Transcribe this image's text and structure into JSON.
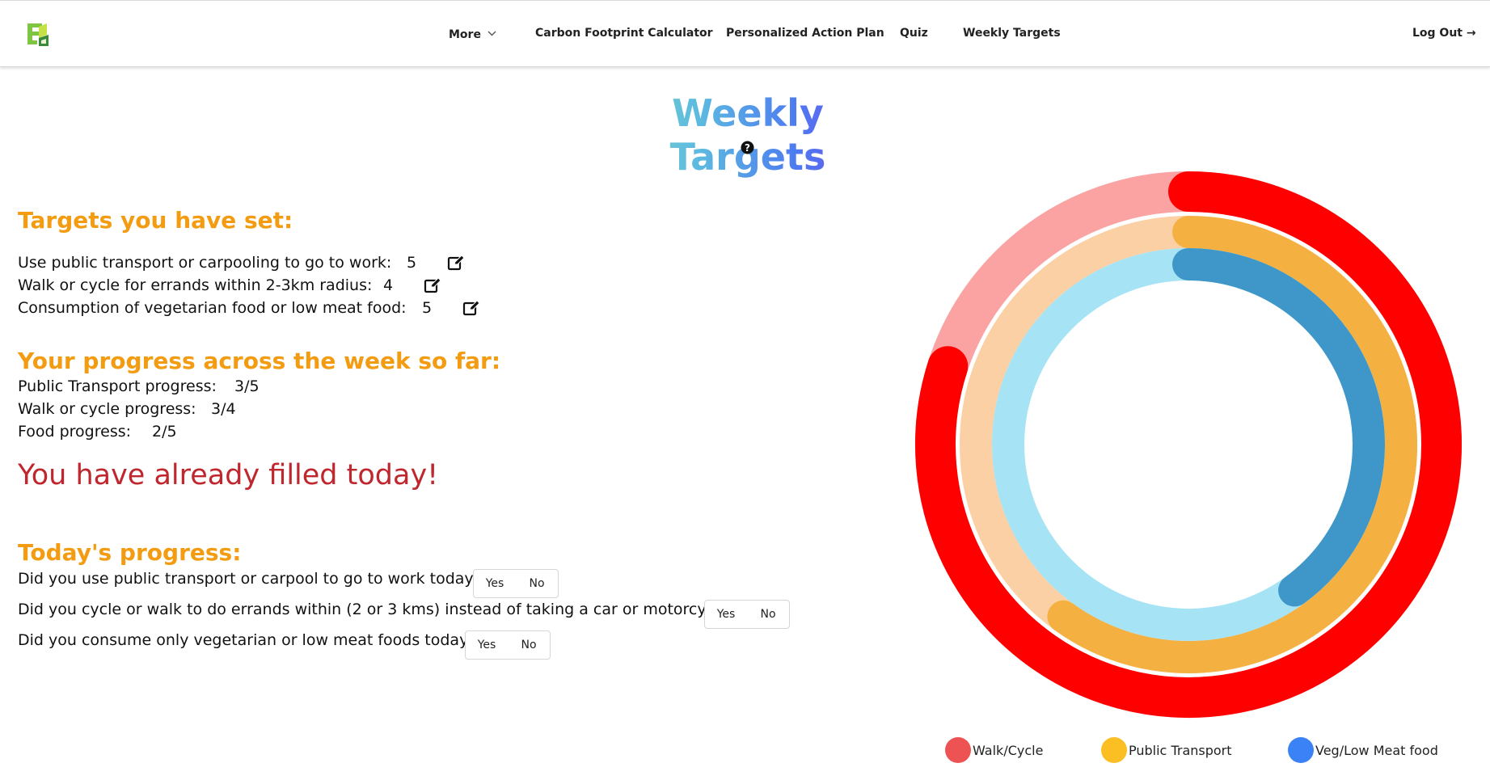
{
  "nav": {
    "more": "More",
    "calculator": "Carbon Footprint Calculator",
    "plan": "Personalized Action Plan",
    "quiz": "Quiz",
    "weekly": "Weekly Targets",
    "logout": "Log Out →"
  },
  "page": {
    "title": "Weekly Targets"
  },
  "targets": {
    "heading": "Targets you have set:",
    "items": [
      {
        "label": "Use public transport or carpooling to go to work:",
        "value": "5"
      },
      {
        "label": "Walk or cycle for errands within 2-3km radius:",
        "value": "4"
      },
      {
        "label": "Consumption of vegetarian food or low meat food:",
        "value": "5"
      }
    ]
  },
  "progress": {
    "heading": "Your progress across the week so far:",
    "items": [
      {
        "label": "Public Transport progress:",
        "value": "3/5"
      },
      {
        "label": "Walk or cycle progress:",
        "value": "3/4"
      },
      {
        "label": "Food progress:",
        "value": "2/5"
      }
    ]
  },
  "filled_message": "You have already filled today!",
  "today": {
    "heading": "Today's progress:",
    "questions": [
      {
        "label": "Did you use public transport or carpool to go to work today?",
        "yes": "Yes",
        "no": "No"
      },
      {
        "label": "Did you cycle or walk to do errands within (2 or 3 kms) instead of taking a car or motorcycle?",
        "yes": "Yes",
        "no": "No"
      },
      {
        "label": "Did you consume only vegetarian or low meat foods today?",
        "yes": "Yes",
        "no": "No"
      }
    ]
  },
  "chart_data": {
    "type": "radial_progress",
    "series": [
      {
        "name": "Walk/Cycle",
        "progress": 0.8,
        "color": "#ff0000",
        "track_color": "#fba3a3"
      },
      {
        "name": "Public Transport",
        "progress": 0.6,
        "color": "#f4b141",
        "track_color": "#fbd0a4"
      },
      {
        "name": "Veg/Low Meat food",
        "progress": 0.4,
        "color": "#3e97c8",
        "track_color": "#a6e3f4"
      }
    ],
    "legend": {
      "items": [
        {
          "label": "Walk/Cycle",
          "color": "#ee5353"
        },
        {
          "label": "Public Transport",
          "color": "#fbbf24"
        },
        {
          "label": "Veg/Low Meat food",
          "color": "#3b82f6"
        }
      ],
      "position": "bottom"
    }
  }
}
